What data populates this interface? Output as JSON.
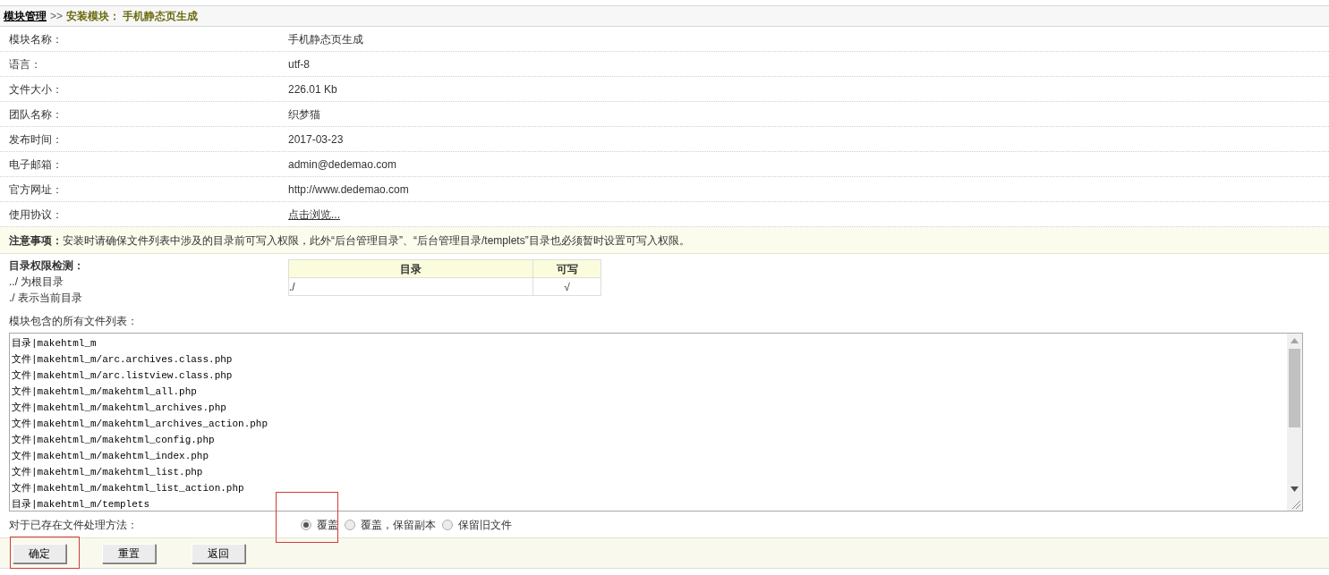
{
  "breadcrumb": {
    "root": "模块管理",
    "separator": ">>",
    "current": "安装模块： 手机静态页生成"
  },
  "info_rows": [
    {
      "label": "模块名称：",
      "value": "手机静态页生成",
      "kind": "text"
    },
    {
      "label": "语言：",
      "value": "utf-8",
      "kind": "text"
    },
    {
      "label": "文件大小：",
      "value": "226.01 Kb",
      "kind": "text"
    },
    {
      "label": "团队名称：",
      "value": "织梦猫",
      "kind": "text"
    },
    {
      "label": "发布时间：",
      "value": "2017-03-23",
      "kind": "text"
    },
    {
      "label": "电子邮箱：",
      "value": "admin@dedemao.com",
      "kind": "text"
    },
    {
      "label": "官方网址：",
      "value": "http://www.dedemao.com",
      "kind": "text"
    },
    {
      "label": "使用协议：",
      "value": "点击浏览...",
      "kind": "link"
    }
  ],
  "notice": {
    "label": "注意事项：",
    "text": "安装时请确保文件列表中涉及的目录前可写入权限，此外“后台管理目录”、“后台管理目录/templets”目录也必须暂时设置可写入权限。"
  },
  "permission_check": {
    "title": "目录权限检测：",
    "notes": [
      "../ 为根目录",
      "./ 表示当前目录"
    ],
    "table": {
      "columns": [
        "目录",
        "可写"
      ],
      "rows": [
        [
          "./",
          "√"
        ]
      ]
    }
  },
  "file_list": {
    "label": "模块包含的所有文件列表：",
    "lines": [
      "目录|makehtml_m",
      "文件|makehtml_m/arc.archives.class.php",
      "文件|makehtml_m/arc.listview.class.php",
      "文件|makehtml_m/makehtml_all.php",
      "文件|makehtml_m/makehtml_archives.php",
      "文件|makehtml_m/makehtml_archives_action.php",
      "文件|makehtml_m/makehtml_config.php",
      "文件|makehtml_m/makehtml_index.php",
      "文件|makehtml_m/makehtml_list.php",
      "文件|makehtml_m/makehtml_list_action.php",
      "目录|makehtml_m/templets"
    ]
  },
  "existing_files": {
    "label": "对于已存在文件处理方法：",
    "options": [
      {
        "label": "覆盖",
        "selected": true
      },
      {
        "label": "覆盖，保留副本",
        "selected": false
      },
      {
        "label": "保留旧文件",
        "selected": false
      }
    ]
  },
  "buttons": [
    "确定",
    "重置",
    "返回"
  ]
}
